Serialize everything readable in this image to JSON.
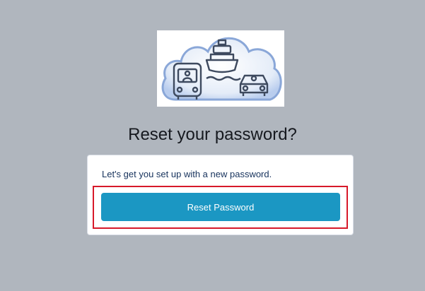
{
  "logo": {
    "icon": "transport-cloud-logo",
    "colors": {
      "stroke": "#3e4a5f",
      "cloud_fill": "#dce7f6",
      "cloud_edge": "#8aa7d8"
    }
  },
  "page": {
    "title": "Reset your password?",
    "background": "#b0b6be"
  },
  "card": {
    "message": "Let's get you set up with a new password.",
    "button_label": "Reset Password",
    "button_color": "#1b97c3",
    "highlight_color": "#d7192a"
  }
}
